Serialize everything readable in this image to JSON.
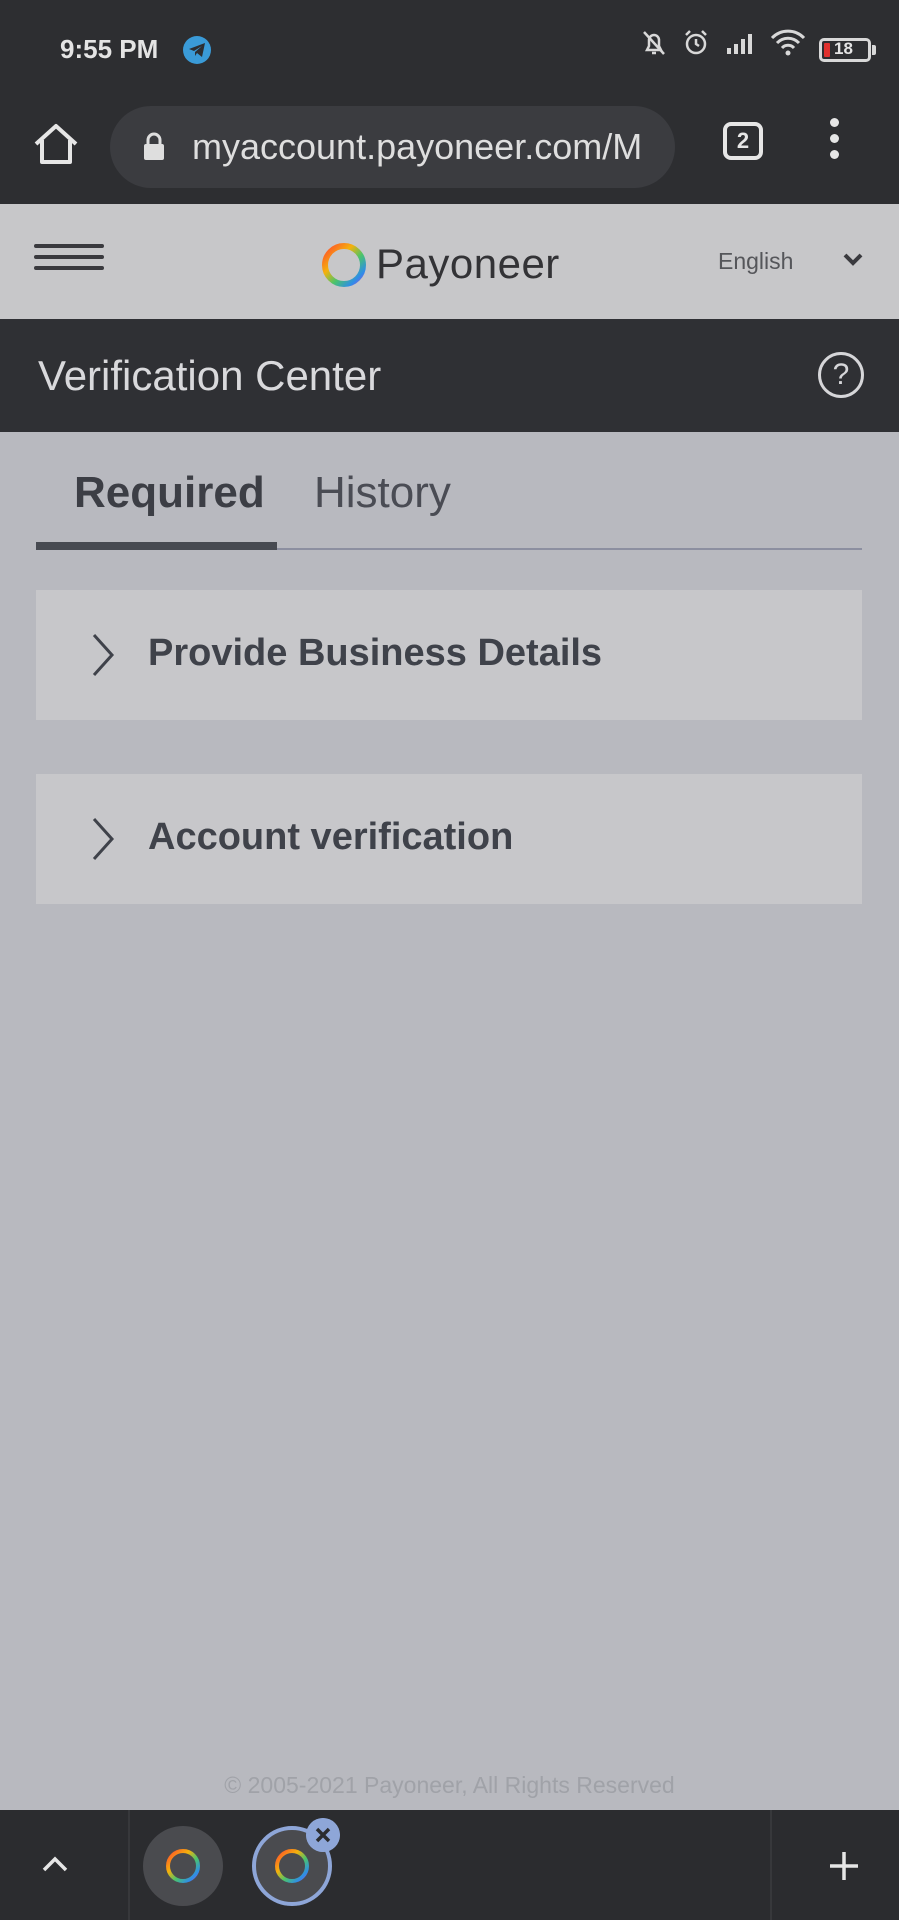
{
  "status_bar": {
    "time": "9:55 PM",
    "battery": "18",
    "icons": [
      "telegram-icon",
      "bell-off-icon",
      "alarm-icon",
      "signal-icon",
      "wifi-icon",
      "battery-icon"
    ]
  },
  "browser": {
    "url": "myaccount.payoneer.com/M",
    "tab_count": "2",
    "icons": [
      "home-icon",
      "lock-icon",
      "tabs-icon",
      "menu-dots-icon"
    ]
  },
  "header": {
    "brand": "Payoneer",
    "language": "English",
    "icons": [
      "hamburger-icon",
      "logo-ring-icon",
      "chevron-down-icon"
    ]
  },
  "title_bar": {
    "title": "Verification Center",
    "help_symbol": "?"
  },
  "tabs": [
    {
      "label": "Required",
      "active": true
    },
    {
      "label": "History",
      "active": false
    }
  ],
  "cards": [
    {
      "label": "Provide Business Details"
    },
    {
      "label": "Account verification"
    }
  ],
  "footer": {
    "copyright": "© 2005-2021 Payoneer, All Rights Reserved"
  },
  "bottom_bar": {
    "icons": [
      "chevron-up-icon",
      "tab-thumbnail-icon",
      "close-icon",
      "plus-icon"
    ]
  },
  "colors": {
    "status_bg": "#2d2e31",
    "header_bg": "#c7c7c9",
    "title_bg": "#2f3034",
    "page_bg": "#b8b9bf",
    "accent_blue": "#8ea6d8"
  }
}
